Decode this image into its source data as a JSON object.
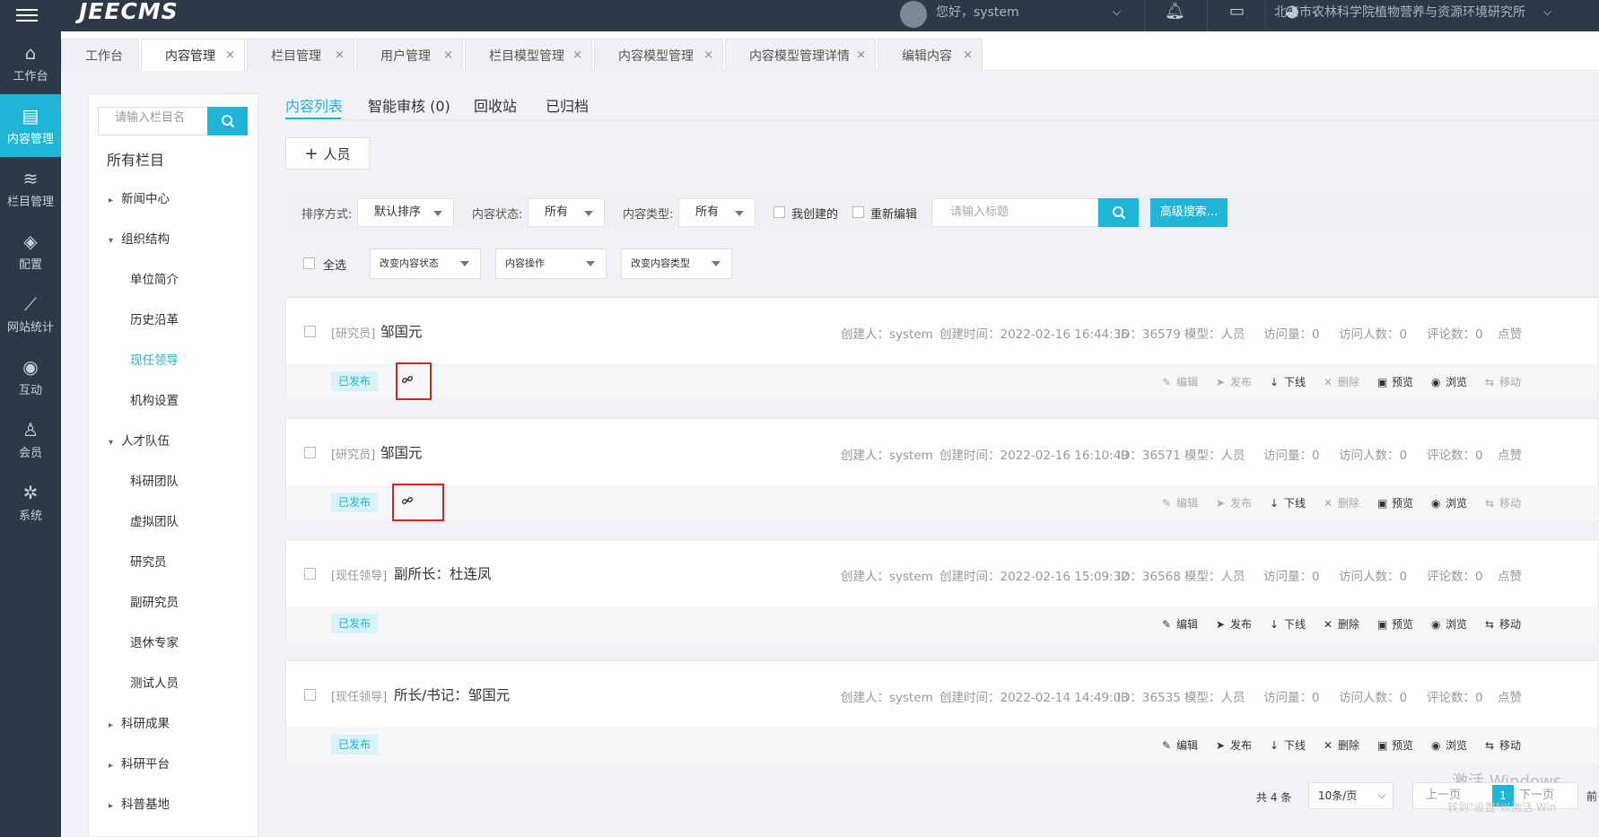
{
  "topbar": {
    "logo": "JEECMS",
    "greeting": "您好，system",
    "site_name": "北京市农林科学院植物营养与资源环境研究所"
  },
  "sidenav": [
    {
      "label": "工作台",
      "icon": "home-icon",
      "glyph": "⌂"
    },
    {
      "label": "内容管理",
      "icon": "document-icon",
      "glyph": "▤"
    },
    {
      "label": "栏目管理",
      "icon": "layers-icon",
      "glyph": "≋"
    },
    {
      "label": "配置",
      "icon": "cube-icon",
      "glyph": "◈"
    },
    {
      "label": "网站统计",
      "icon": "chart-icon",
      "glyph": "⟋"
    },
    {
      "label": "互动",
      "icon": "chat-icon",
      "glyph": "◉"
    },
    {
      "label": "会员",
      "icon": "user-icon",
      "glyph": "♙"
    },
    {
      "label": "系统",
      "icon": "gear-icon",
      "glyph": "✲"
    }
  ],
  "tabs": [
    {
      "label": "工作台",
      "closable": false
    },
    {
      "label": "内容管理",
      "closable": true
    },
    {
      "label": "栏目管理",
      "closable": true
    },
    {
      "label": "用户管理",
      "closable": true
    },
    {
      "label": "栏目模型管理",
      "closable": true
    },
    {
      "label": "内容模型管理",
      "closable": true
    },
    {
      "label": "内容模型管理详情",
      "closable": true
    },
    {
      "label": "编辑内容",
      "closable": true
    }
  ],
  "column_panel": {
    "search_placeholder": "请输入栏目名",
    "all_label": "所有栏目",
    "tree": [
      {
        "label": "新闻中心",
        "level": 0,
        "arrow": "▸"
      },
      {
        "label": "组织结构",
        "level": 0,
        "arrow": "▾"
      },
      {
        "label": "单位简介",
        "level": 1
      },
      {
        "label": "历史沿革",
        "level": 1
      },
      {
        "label": "现任领导",
        "level": 1,
        "selected": true
      },
      {
        "label": "机构设置",
        "level": 1
      },
      {
        "label": "人才队伍",
        "level": 0,
        "arrow": "▾"
      },
      {
        "label": "科研团队",
        "level": 1
      },
      {
        "label": "虚拟团队",
        "level": 1
      },
      {
        "label": "研究员",
        "level": 1
      },
      {
        "label": "副研究员",
        "level": 1
      },
      {
        "label": "退休专家",
        "level": 1
      },
      {
        "label": "测试人员",
        "level": 1
      },
      {
        "label": "科研成果",
        "level": 0,
        "arrow": "▸"
      },
      {
        "label": "科研平台",
        "level": 0,
        "arrow": "▸"
      },
      {
        "label": "科普基地",
        "level": 0,
        "arrow": "▸"
      }
    ]
  },
  "subtabs": [
    "内容列表",
    "智能审核 (0)",
    "回收站",
    "已归档"
  ],
  "add_button": "人员",
  "filter": {
    "sort_label": "排序方式:",
    "sort_value": "默认排序",
    "status_label": "内容状态:",
    "status_value": "所有",
    "type_label": "内容类型:",
    "type_value": "所有",
    "mine_label": "我创建的",
    "reedit_label": "重新编辑",
    "title_placeholder": "请输入标题",
    "advanced_label": "高级搜索..."
  },
  "bulk": {
    "select_all": "全选",
    "change_status": "改变内容状态",
    "content_ops": "内容操作",
    "change_type": "改变内容类型"
  },
  "items": [
    {
      "category": "[研究员]",
      "title": "邹国元",
      "creator": "创建人：system",
      "created": "创建时间：2022-02-16 16:44:36",
      "id": "ID：36579",
      "model": "模型：人员",
      "visits": "访问量：0",
      "visitors": "访问人数：0",
      "comments": "评论数：0",
      "likes": "点赞",
      "status": "已发布",
      "has_link": true,
      "highlight": true,
      "actions_dim": true
    },
    {
      "category": "[研究员]",
      "title": "邹国元",
      "creator": "创建人：system",
      "created": "创建时间：2022-02-16 16:10:49",
      "id": "ID：36571",
      "model": "模型：人员",
      "visits": "访问量：0",
      "visitors": "访问人数：0",
      "comments": "评论数：0",
      "likes": "点赞",
      "status": "已发布",
      "has_link": true,
      "highlight": true,
      "actions_dim": true
    },
    {
      "category": "[现任领导]",
      "title": "副所长：杜连凤",
      "creator": "创建人：system",
      "created": "创建时间：2022-02-16 15:09:32",
      "id": "ID：36568",
      "model": "模型：人员",
      "visits": "访问量：0",
      "visitors": "访问人数：0",
      "comments": "评论数：0",
      "likes": "点赞",
      "status": "已发布",
      "has_link": false,
      "highlight": false,
      "actions_dim": false
    },
    {
      "category": "[现任领导]",
      "title": "所长/书记：邹国元",
      "creator": "创建人：system",
      "created": "创建时间：2022-02-14 14:49:03",
      "id": "ID：36535",
      "model": "模型：人员",
      "visits": "访问量：0",
      "visitors": "访问人数：0",
      "comments": "评论数：0",
      "likes": "点赞",
      "status": "已发布",
      "has_link": false,
      "highlight": false,
      "actions_dim": false
    }
  ],
  "actions": [
    {
      "label": "编辑",
      "glyph": "✎",
      "icon": "edit-icon",
      "dim": true
    },
    {
      "label": "发布",
      "glyph": "➤",
      "icon": "send-icon",
      "dim": true
    },
    {
      "label": "下线",
      "glyph": "↓",
      "icon": "download-icon",
      "dim": false
    },
    {
      "label": "删除",
      "glyph": "✕",
      "icon": "delete-icon",
      "dim": true
    },
    {
      "label": "预览",
      "glyph": "▣",
      "icon": "preview-icon",
      "dim": false
    },
    {
      "label": "浏览",
      "glyph": "◉",
      "icon": "eye-icon",
      "dim": false
    },
    {
      "label": "移动",
      "glyph": "⇆",
      "icon": "move-icon",
      "dim": true
    }
  ],
  "pager": {
    "total": "共 4 条",
    "page_size": "10条/页",
    "prev": "上一页",
    "current": "1",
    "next": "下一页",
    "jump": "前"
  },
  "watermark": {
    "line1": "激活 Windows",
    "line2": "转到\"设置\"以激活 Win"
  },
  "colors": {
    "accent": "#1fb5d6",
    "sidebar": "#2b3a46",
    "highlight_box": "#e02020"
  }
}
